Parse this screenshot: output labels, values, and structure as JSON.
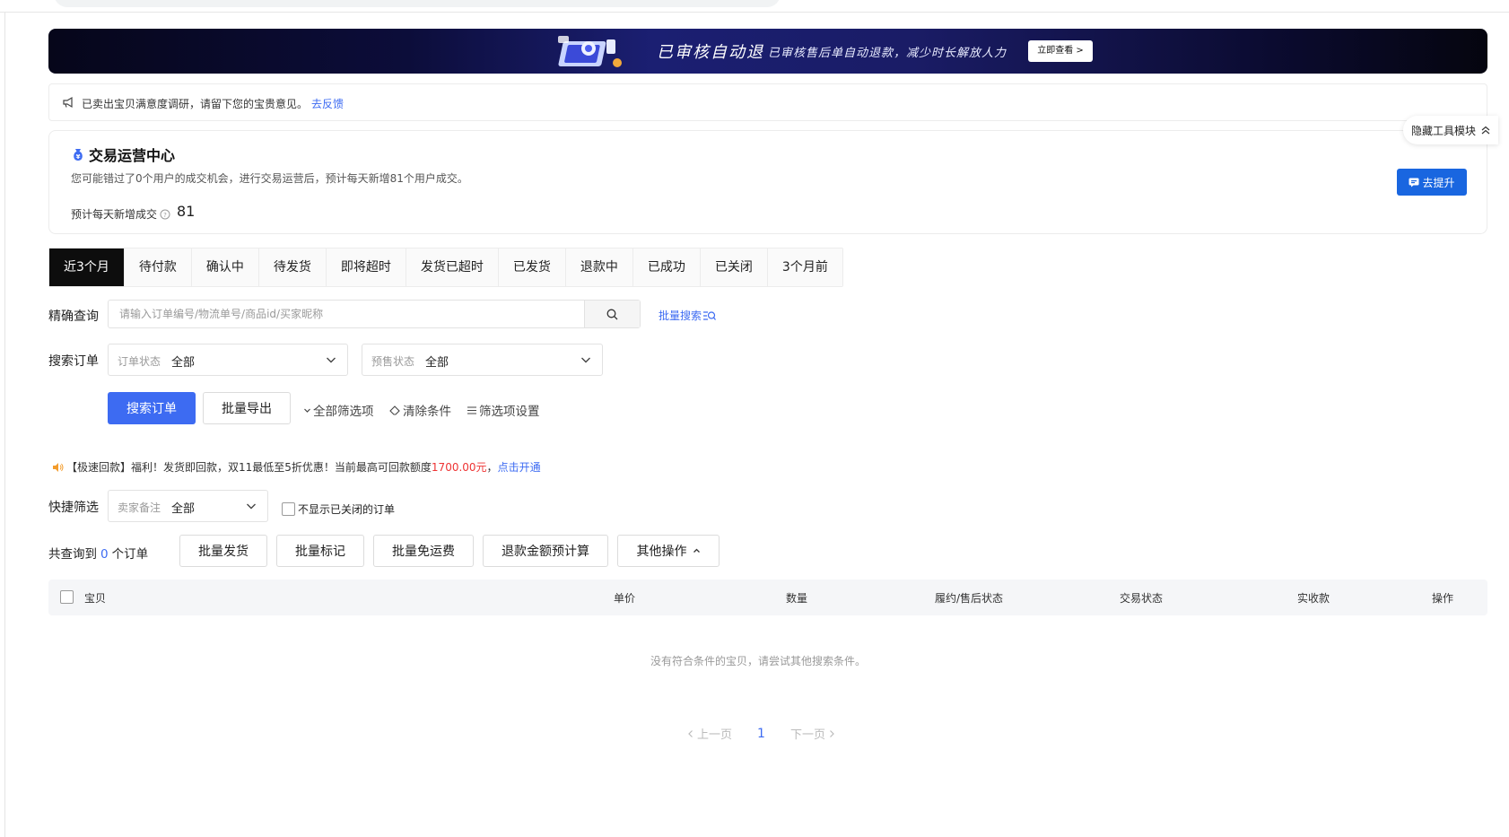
{
  "banner": {
    "title": "已审核自动退",
    "subtitle": "已审核售后单自动退款，减少时长解放人力",
    "button": "立即查看 >"
  },
  "notice": {
    "text": "已卖出宝贝满意度调研，请留下您的宝贵意见。",
    "link": "去反馈"
  },
  "trade_center": {
    "title": "交易运营中心",
    "desc": "您可能错过了0个用户的成交机会，进行交易运营后，预计每天新增81个用户成交。",
    "metric_label": "预计每天新增成交",
    "metric_value": "81",
    "button": "去提升"
  },
  "hide_tools": "隐藏工具模块",
  "tabs": [
    "近3个月",
    "待付款",
    "确认中",
    "待发货",
    "即将超时",
    "发货已超时",
    "已发货",
    "退款中",
    "已成功",
    "已关闭",
    "3个月前"
  ],
  "search": {
    "label": "精确查询",
    "placeholder": "请输入订单编号/物流单号/商品id/买家昵称",
    "batch_search": "批量搜索"
  },
  "filters": {
    "label": "搜索订单",
    "order_status_label": "订单状态",
    "order_status_value": "全部",
    "presale_status_label": "预售状态",
    "presale_status_value": "全部"
  },
  "actions": {
    "search": "搜索订单",
    "export": "批量导出",
    "all_filters": "全部筛选项",
    "clear": "清除条件",
    "settings": "筛选项设置"
  },
  "promo": {
    "prefix": "【极速回款】福利！发货即回款，双11最低至5折优惠！当前最高可回款额度",
    "amount": "1700.00元",
    "sep": "，",
    "link": "点击开通"
  },
  "quick_filter": {
    "label": "快捷筛选",
    "seller_note_label": "卖家备注",
    "seller_note_value": "全部",
    "hide_closed": "不显示已关闭的订单"
  },
  "summary": {
    "prefix": "共查询到",
    "count": "0",
    "suffix": "个订单"
  },
  "bulk_buttons": [
    "批量发货",
    "批量标记",
    "批量免运费",
    "退款金额预计算",
    "其他操作"
  ],
  "table": {
    "columns": [
      "宝贝",
      "单价",
      "数量",
      "履约/售后状态",
      "交易状态",
      "实收款",
      "操作"
    ],
    "empty": "没有符合条件的宝贝，请尝试其他搜索条件。"
  },
  "pagination": {
    "prev": "上一页",
    "current": "1",
    "next": "下一页"
  }
}
